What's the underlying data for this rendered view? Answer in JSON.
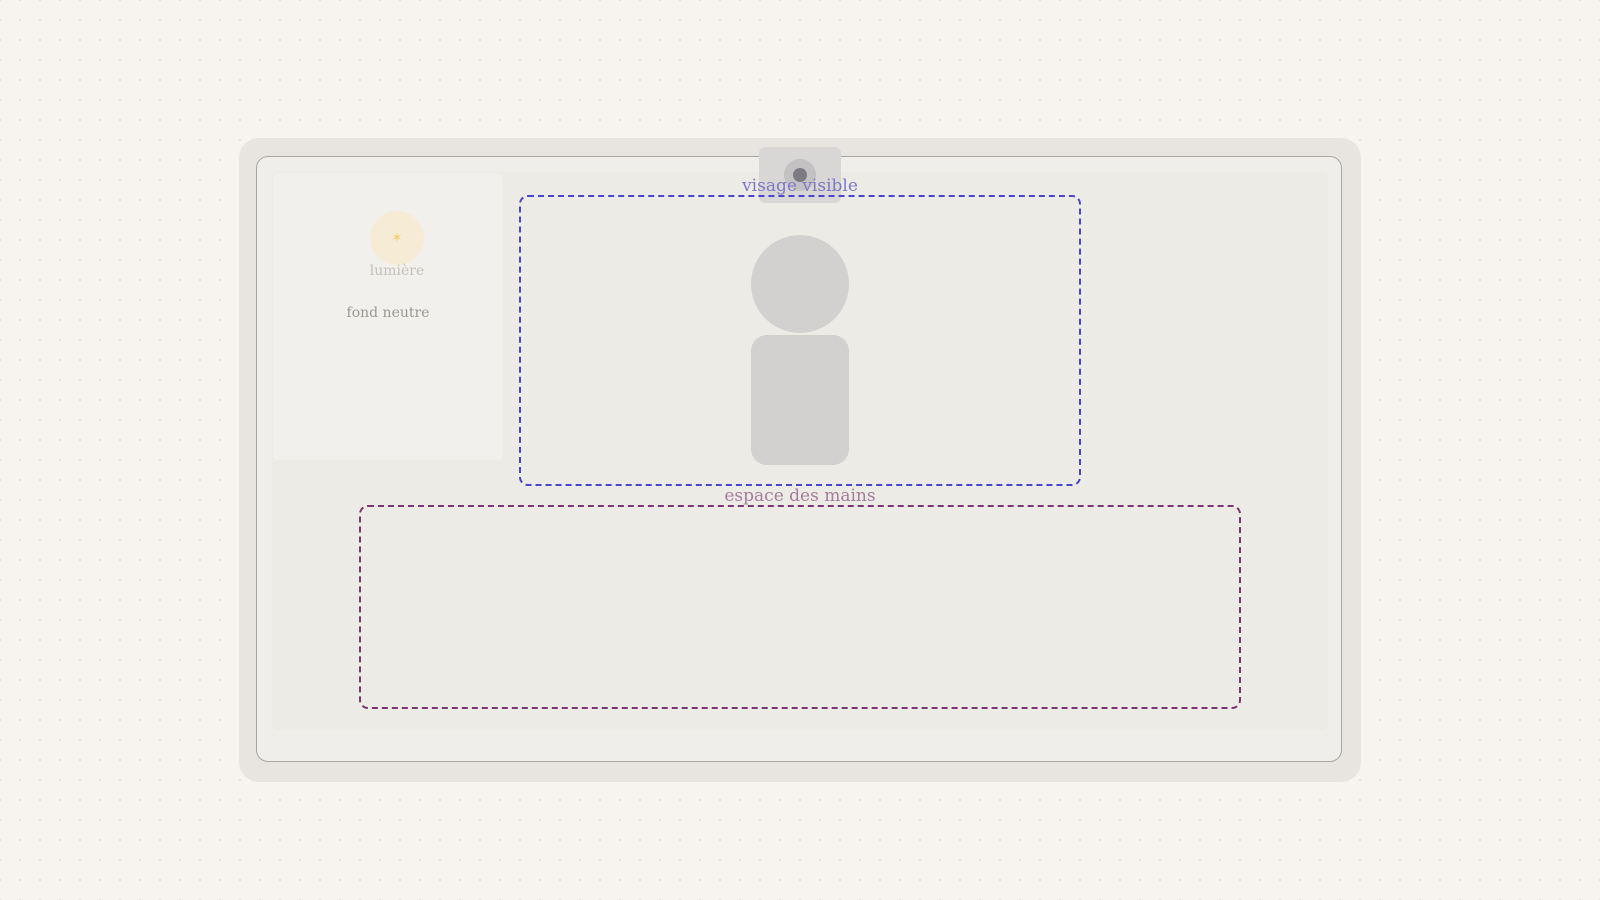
{
  "colors": {
    "page_background": "#f7f3ee",
    "face_zone_border": "#4b44cf",
    "face_zone_label": "#7d78c6",
    "hands_zone_border": "#7c3472",
    "hands_zone_label": "#a47c9c",
    "light_source": "#f6ecd6",
    "silhouette": "#d2d1cf"
  },
  "lighting": {
    "icon": "sun-icon",
    "label": "lumière"
  },
  "background": {
    "label": "fond neutre"
  },
  "webcam": {
    "icon": "webcam-icon"
  },
  "zones": {
    "face": {
      "label": "visage visible"
    },
    "hands": {
      "label": "espace des mains"
    }
  }
}
